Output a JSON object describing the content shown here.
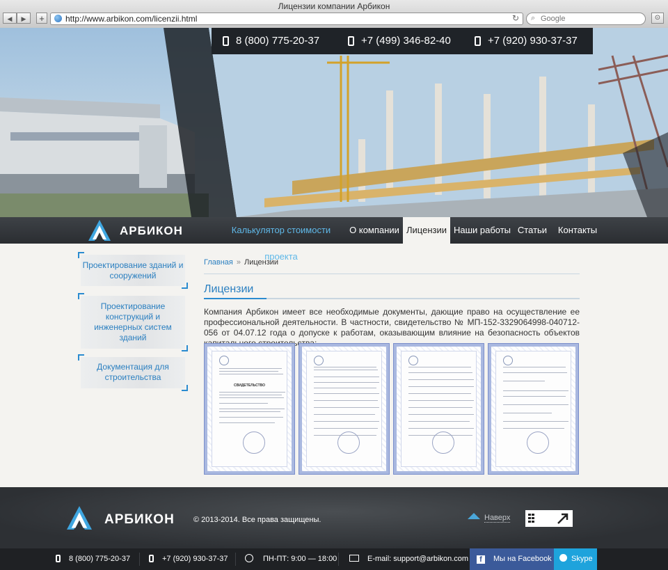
{
  "browser": {
    "window_title": "Лицензии компании Арбикон",
    "url": "http://www.arbikon.com/licenzii.html",
    "search_placeholder": "Google"
  },
  "header": {
    "phones": [
      "8 (800) 775-20-37",
      "+7 (499) 346-82-40",
      "+7 (920) 930-37-37"
    ]
  },
  "nav": {
    "logo_text": "АРБИКОН",
    "items": [
      {
        "label": "Калькулятор стоимости проекта"
      },
      {
        "label": "О компании"
      },
      {
        "label": "Лицензии"
      },
      {
        "label": "Наши работы"
      },
      {
        "label": "Статьи"
      },
      {
        "label": "Контакты"
      }
    ],
    "accent_color": "#5fb8e8"
  },
  "sidebar": {
    "items": [
      {
        "label": "Проектирование зданий и сооружений"
      },
      {
        "label": "Проектирование конструкций и инженерных систем зданий"
      },
      {
        "label": "Документация для строительства"
      }
    ]
  },
  "breadcrumb": {
    "home": "Главная",
    "separator": "»",
    "current": "Лицензии"
  },
  "main": {
    "title": "Лицензии",
    "intro": "Компания Арбикон имеет все необходимые документы, дающие право на осуществление ее профессиональной деятельности. В частности, свидетельство № МП-152-3329064998-040712-056 от 04.07.12 года о допуске к работам, оказывающим влияние на безопасность объектов капитального строительства:",
    "documents_count_visible": 4,
    "document_heading": "СВИДЕТЕЛЬСТВО"
  },
  "footer": {
    "logo_text": "АРБИКОН",
    "copyright": "© 2013-2014. Все права защищены.",
    "to_top": "Наверх"
  },
  "bottombar": {
    "phone1": "8 (800) 775-20-37",
    "phone2": "+7 (920) 930-37-37",
    "hours": "ПН-ПТ: 9:00 — 18:00",
    "email": "E-mail: support@arbikon.com",
    "facebook": "Мы на Facebook",
    "skype": "Skype"
  },
  "colors": {
    "brand_blue": "#2a7fc0",
    "nav_dark": "#2f3236",
    "facebook": "#3b5a9a",
    "skype": "#1ea3dc"
  }
}
